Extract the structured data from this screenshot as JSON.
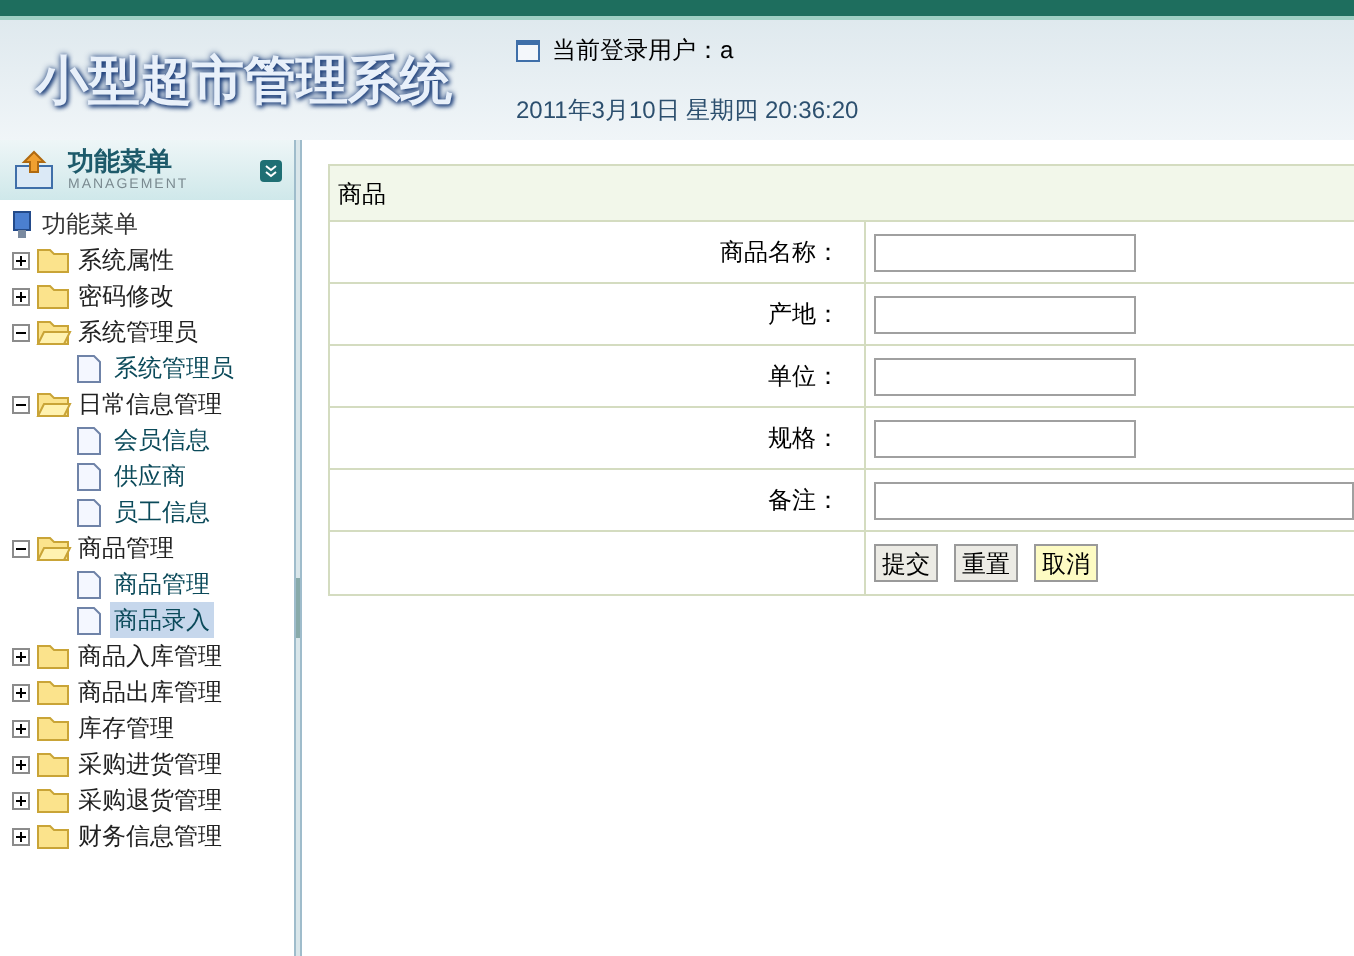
{
  "header": {
    "title": "小型超市管理系统",
    "user_label": "当前登录用户：a",
    "datetime": "2011年3月10日  星期四  20:36:20"
  },
  "sidebar": {
    "title": "功能菜单",
    "subtitle": "MANAGEMENT",
    "tree": {
      "label": "功能菜单",
      "children": [
        {
          "label": "系统属性",
          "expanded": false
        },
        {
          "label": "密码修改",
          "expanded": false
        },
        {
          "label": "系统管理员",
          "expanded": true,
          "children": [
            {
              "label": "系统管理员",
              "selected": false
            }
          ]
        },
        {
          "label": "日常信息管理",
          "expanded": true,
          "children": [
            {
              "label": "会员信息",
              "selected": false
            },
            {
              "label": "供应商",
              "selected": false
            },
            {
              "label": "员工信息",
              "selected": false
            }
          ]
        },
        {
          "label": "商品管理",
          "expanded": true,
          "children": [
            {
              "label": "商品管理",
              "selected": false
            },
            {
              "label": "商品录入",
              "selected": true
            }
          ]
        },
        {
          "label": "商品入库管理",
          "expanded": false
        },
        {
          "label": "商品出库管理",
          "expanded": false
        },
        {
          "label": "库存管理",
          "expanded": false
        },
        {
          "label": "采购进货管理",
          "expanded": false
        },
        {
          "label": "采购退货管理",
          "expanded": false
        },
        {
          "label": "财务信息管理",
          "expanded": false
        }
      ]
    }
  },
  "form": {
    "title": "商品",
    "fields": [
      {
        "label": "商品名称：",
        "wide": false
      },
      {
        "label": "产地：",
        "wide": false
      },
      {
        "label": "单位：",
        "wide": false
      },
      {
        "label": "规格：",
        "wide": false
      },
      {
        "label": "备注：",
        "wide": true
      }
    ],
    "buttons": [
      {
        "label": "提交",
        "hovered": false
      },
      {
        "label": "重置",
        "hovered": false
      },
      {
        "label": "取消",
        "hovered": true
      }
    ]
  }
}
